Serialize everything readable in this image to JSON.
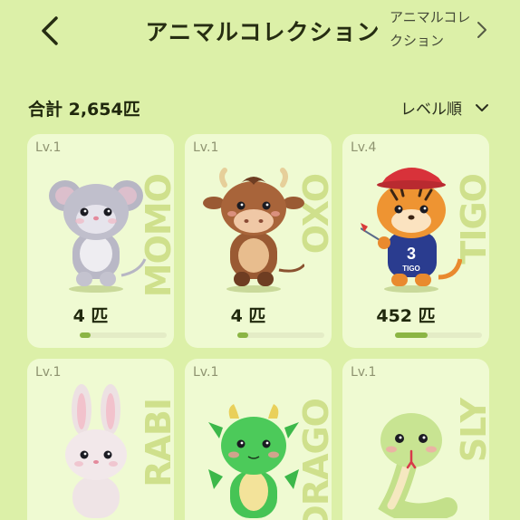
{
  "header": {
    "title": "アニマルコレクション",
    "side_link": "アニマルコレクション"
  },
  "summary": {
    "total_label": "合計 2,654匹",
    "sort_label": "レベル順"
  },
  "cards": [
    {
      "level": "Lv.1",
      "name": "MOMO",
      "count": "4 匹",
      "progress": 0.12
    },
    {
      "level": "Lv.1",
      "name": "OXO",
      "count": "4 匹",
      "progress": 0.12
    },
    {
      "level": "Lv.4",
      "name": "TIGO",
      "count": "452 匹",
      "progress": 0.38
    },
    {
      "level": "Lv.1",
      "name": "RABI",
      "count": "",
      "progress": null
    },
    {
      "level": "Lv.1",
      "name": "DRAGO",
      "count": "",
      "progress": null
    },
    {
      "level": "Lv.1",
      "name": "SLY",
      "count": "",
      "progress": null
    }
  ],
  "colors": {
    "background": "#dcf0a8",
    "card": "#f5fcde",
    "progress_fill": "#8bb544",
    "progress_track": "#e4ecc6",
    "vertical_name": "#cfe08c"
  },
  "icons": [
    "back-chevron-icon",
    "chevron-right-icon",
    "chevron-down-icon"
  ]
}
